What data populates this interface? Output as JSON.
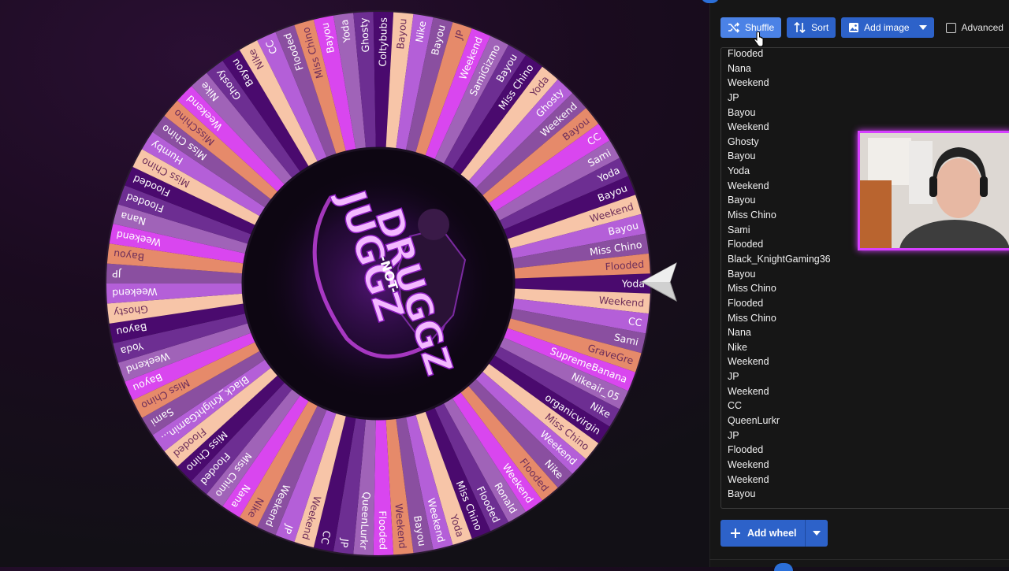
{
  "colors": {
    "panel_bg": "#161616",
    "button_blue": "#2d62c9",
    "shuffle_blue": "#4b82e6",
    "wheel_palette": [
      "#4a0a6e",
      "#f7c5a8",
      "#b45fd8",
      "#8a4fa0",
      "#e68a6a",
      "#d946ef",
      "#a063b8",
      "#6d2e92"
    ],
    "webcam_border": "#d640ff"
  },
  "toolbar": {
    "shuffle_label": "Shuffle",
    "shuffle_icon": "shuffle-icon",
    "sort_label": "Sort",
    "sort_icon": "sort-icon",
    "add_image_label": "Add image",
    "add_image_icon": "image-icon",
    "advanced_label": "Advanced"
  },
  "entries": [
    "Flooded",
    "Nana",
    "Weekend",
    "JP",
    "Bayou",
    "Weekend",
    "Ghosty",
    "Bayou",
    "Yoda",
    "Weekend",
    "Bayou",
    "Miss Chino",
    "Sami",
    "Flooded",
    "Black_KnightGaming36",
    "Bayou",
    "Miss Chino",
    "Flooded",
    "Miss Chino",
    "Nana",
    "Nike",
    "Weekend",
    "JP",
    "Weekend",
    "CC",
    "QueenLurkr",
    "JP",
    "Flooded",
    "Weekend",
    "Weekend",
    "Bayou"
  ],
  "add_wheel": {
    "label": "Add wheel",
    "icon": "plus-icon"
  },
  "wheel": {
    "center_logo_text": [
      "JUGGZ",
      "-NOT-",
      "DRUGGZ"
    ],
    "segments": [
      "Yoda",
      "Weekend",
      "CC",
      "Sami",
      "GraveGre",
      "SupremeBanana",
      "Nikeair_05",
      "Nike",
      "organicvirgin",
      "Miss Chino",
      "Weekend",
      "Nike",
      "Flooded",
      "Weekend",
      "Ronald",
      "Flooded",
      "Miss Chino",
      "Yoda",
      "Weekend",
      "Bayou",
      "Weekend",
      "Flooded",
      "QueenLurkr",
      "JP",
      "CC",
      "Weekend",
      "JP",
      "Weekend",
      "Nike",
      "Nana",
      "Miss Chino",
      "Flooded",
      "Miss Chino",
      "Flooded",
      "Black_KnightGamin...",
      "Sami",
      "Miss Chino",
      "Bayou",
      "Weekend",
      "Yoda",
      "Bayou",
      "Ghosty",
      "Weekend",
      "JP",
      "Bayou",
      "Weekend",
      "Nana",
      "Flooded",
      "Flooded",
      "Miss Chino",
      "Humby",
      "Miss Chino",
      "MissChino",
      "Weekend",
      "Nike",
      "Ghosty",
      "Bayou",
      "Nike",
      "CC",
      "Flooded",
      "Miss Chino",
      "Bayou",
      "Yoda",
      "Ghosty",
      "Coltybubs",
      "Bayou",
      "Nike",
      "Bayou",
      "JP",
      "Weekend",
      "SamiGizmo",
      "Bayou",
      "Miss Chino",
      "Yoda",
      "Ghosty",
      "Weekend",
      "Bayou",
      "CC",
      "Sami",
      "Yoda",
      "Bayou",
      "Weekend",
      "Bayou",
      "Miss Chino",
      "Flooded"
    ]
  }
}
